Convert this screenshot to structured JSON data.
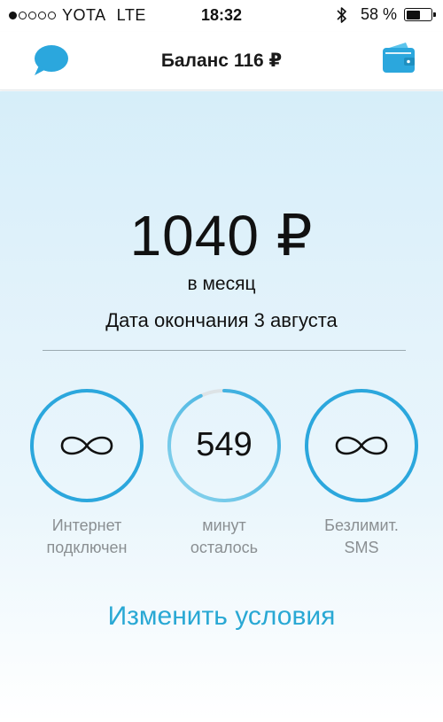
{
  "status_bar": {
    "signal_dots": [
      true,
      false,
      false,
      false,
      false
    ],
    "carrier": "YOTA",
    "network": "LTE",
    "time": "18:32",
    "battery_percent_label": "58 %",
    "battery_level": 0.58
  },
  "nav": {
    "title": "Баланс 116 ₽",
    "chat_icon": "chat-bubble-icon",
    "wallet_icon": "wallet-icon",
    "accent_color": "#2ba7dd"
  },
  "tariff": {
    "price": "1040 ₽",
    "period": "в месяц",
    "end_date": "Дата окончания 3 августа"
  },
  "gauges": [
    {
      "value": "",
      "icon": "infinity-icon",
      "caption_line1": "Интернет",
      "caption_line2": "подключен",
      "fill_fraction": 1.0
    },
    {
      "value": "549",
      "icon": "",
      "caption_line1": "минут",
      "caption_line2": "осталось",
      "fill_fraction": 0.93
    },
    {
      "value": "",
      "icon": "infinity-icon",
      "caption_line1": "Безлимит.",
      "caption_line2": "SMS",
      "fill_fraction": 1.0
    }
  ],
  "action": {
    "change_terms": "Изменить условия"
  },
  "colors": {
    "ring": "#2ba7dd",
    "ring_track": "#dde3e6",
    "link": "#29a8d4",
    "caption": "#8a8f92"
  }
}
